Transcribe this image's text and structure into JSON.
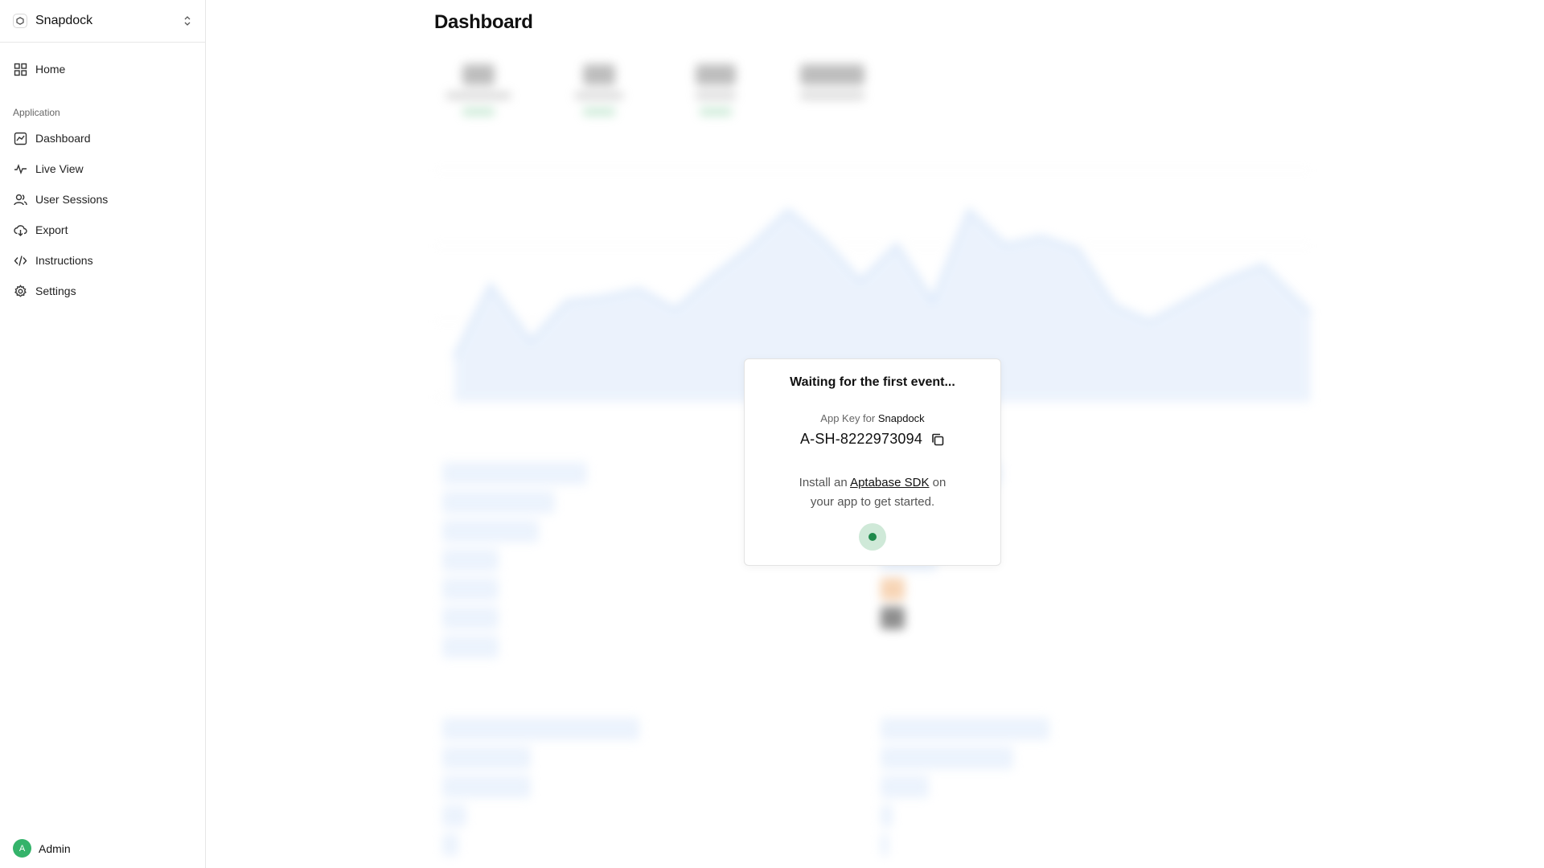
{
  "app": {
    "name": "Snapdock"
  },
  "sidebar": {
    "home": {
      "label": "Home",
      "icon": "grid-icon"
    },
    "section_label": "Application",
    "items": [
      {
        "label": "Dashboard",
        "icon": "chart-icon"
      },
      {
        "label": "Live View",
        "icon": "activity-icon"
      },
      {
        "label": "User Sessions",
        "icon": "users-icon"
      },
      {
        "label": "Export",
        "icon": "cloud-download-icon"
      },
      {
        "label": "Instructions",
        "icon": "code-icon"
      },
      {
        "label": "Settings",
        "icon": "gear-icon"
      }
    ],
    "user": {
      "initial": "A",
      "name": "Admin",
      "avatar_color": "#34b36a"
    }
  },
  "page": {
    "title": "Dashboard"
  },
  "modal": {
    "title": "Waiting for the first event...",
    "appkey_prefix": "App Key for",
    "appkey_app": "Snapdock",
    "appkey": "A-SH-8222973094",
    "install_prefix": "Install an",
    "install_link": "Aptabase SDK",
    "install_suffix": "on your app to get started.",
    "status_color": "#1f8a4c"
  },
  "colors": {
    "accent": "#1f8a4c",
    "chart_fill": "#dce9fb"
  }
}
